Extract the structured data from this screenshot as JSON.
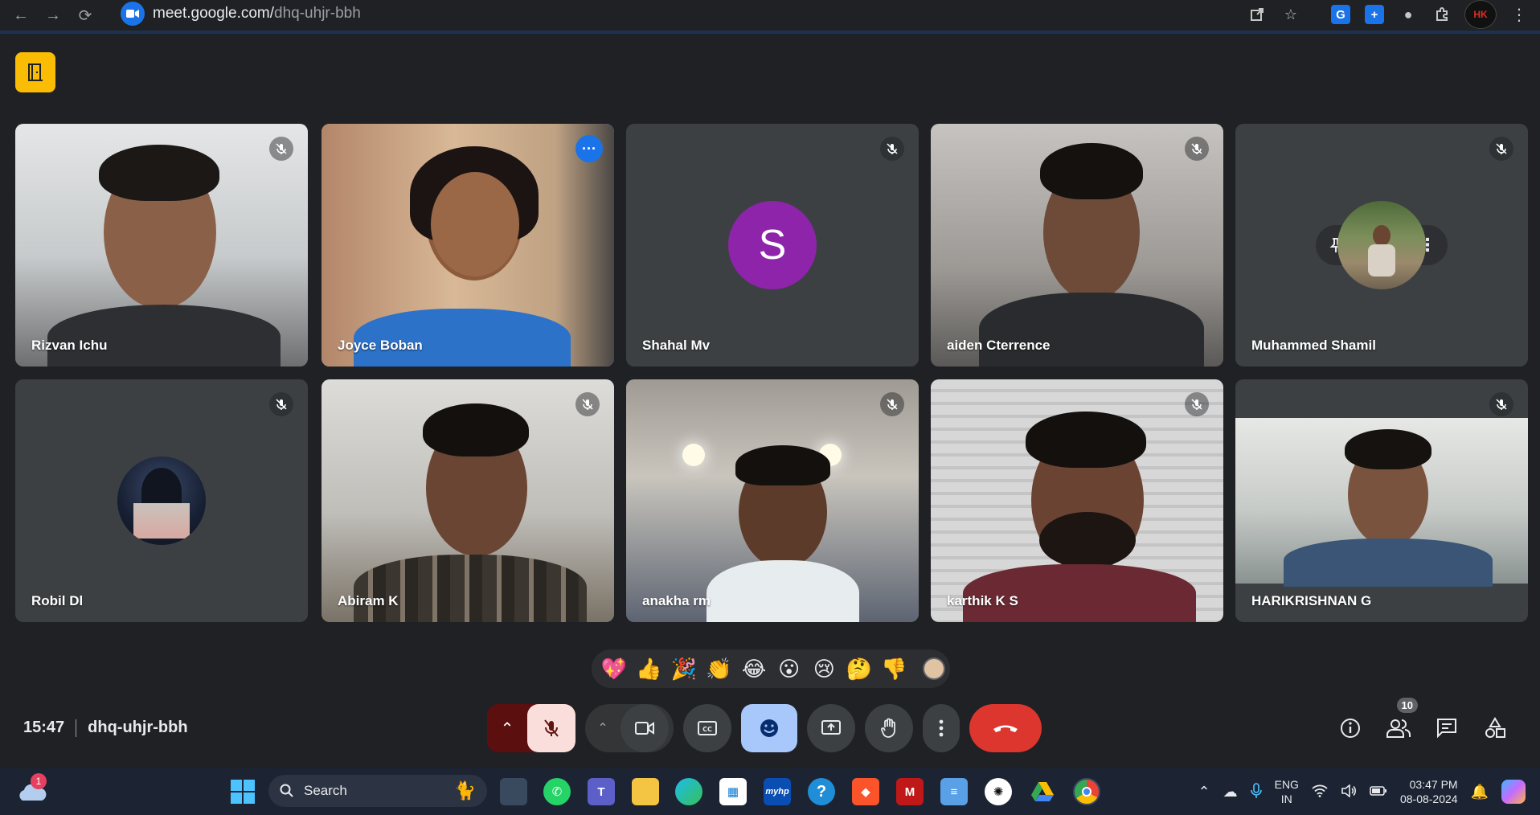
{
  "browser": {
    "url_host": "meet.google.com/",
    "url_path": "dhq-uhjr-bbh",
    "profile_label": "HK"
  },
  "tiles": [
    {
      "name": "Rizvan Ichu",
      "type": "video",
      "bg": "#cfd2d4"
    },
    {
      "name": "Joyce Boban",
      "type": "video",
      "bg": "#c8a883"
    },
    {
      "name": "Shahal Mv",
      "type": "letter",
      "letter": "S",
      "color": "#8e24aa"
    },
    {
      "name": "aiden Cterrence",
      "type": "video",
      "bg": "#a5a3a0"
    },
    {
      "name": "Muhammed Shamil",
      "type": "photo"
    },
    {
      "name": "Robil Dl",
      "type": "photo"
    },
    {
      "name": "Abiram K",
      "type": "video",
      "bg": "#c9c9c5"
    },
    {
      "name": "anakha rm",
      "type": "video",
      "bg": "#b8b4aa"
    },
    {
      "name": "karthik K S",
      "type": "video",
      "bg": "#cfcfcf"
    },
    {
      "name": "HARIKRISHNAN G",
      "type": "video",
      "bg": "#bfc3c0"
    }
  ],
  "reactions": [
    "💖",
    "👍",
    "🎉",
    "👏",
    "😂",
    "😮",
    "😢",
    "🤔",
    "👎"
  ],
  "meeting": {
    "time": "15:47",
    "code": "dhq-uhjr-bbh",
    "participant_count": "10"
  },
  "taskbar": {
    "weather_badge": "1",
    "search_label": "Search",
    "lang_top": "ENG",
    "lang_bottom": "IN",
    "clock_time": "03:47 PM",
    "clock_date": "08-08-2024",
    "hp_label": "myhp"
  }
}
